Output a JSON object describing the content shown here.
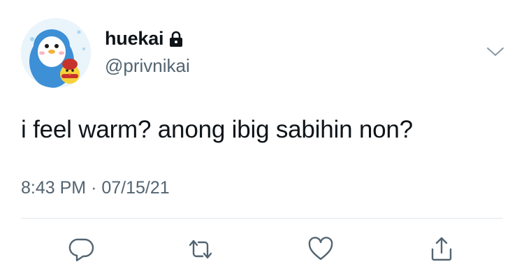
{
  "user": {
    "display_name": "huekai",
    "handle": "@privnikai",
    "avatar": "penguin-avatar",
    "protected_icon": "lock-icon"
  },
  "tweet": {
    "text": "i feel warm? anong ibig sabihin non?",
    "time": "8:43 PM",
    "separator": "·",
    "date": "07/15/21"
  },
  "menu": {
    "icon": "chevron-down-icon"
  },
  "actions": {
    "reply_icon": "reply-icon",
    "retweet_icon": "retweet-icon",
    "like_icon": "heart-icon",
    "share_icon": "share-icon"
  },
  "colors": {
    "text": "#0f1419",
    "secondary": "#536471",
    "divider": "#e1e8ed",
    "icon": "#536471"
  }
}
